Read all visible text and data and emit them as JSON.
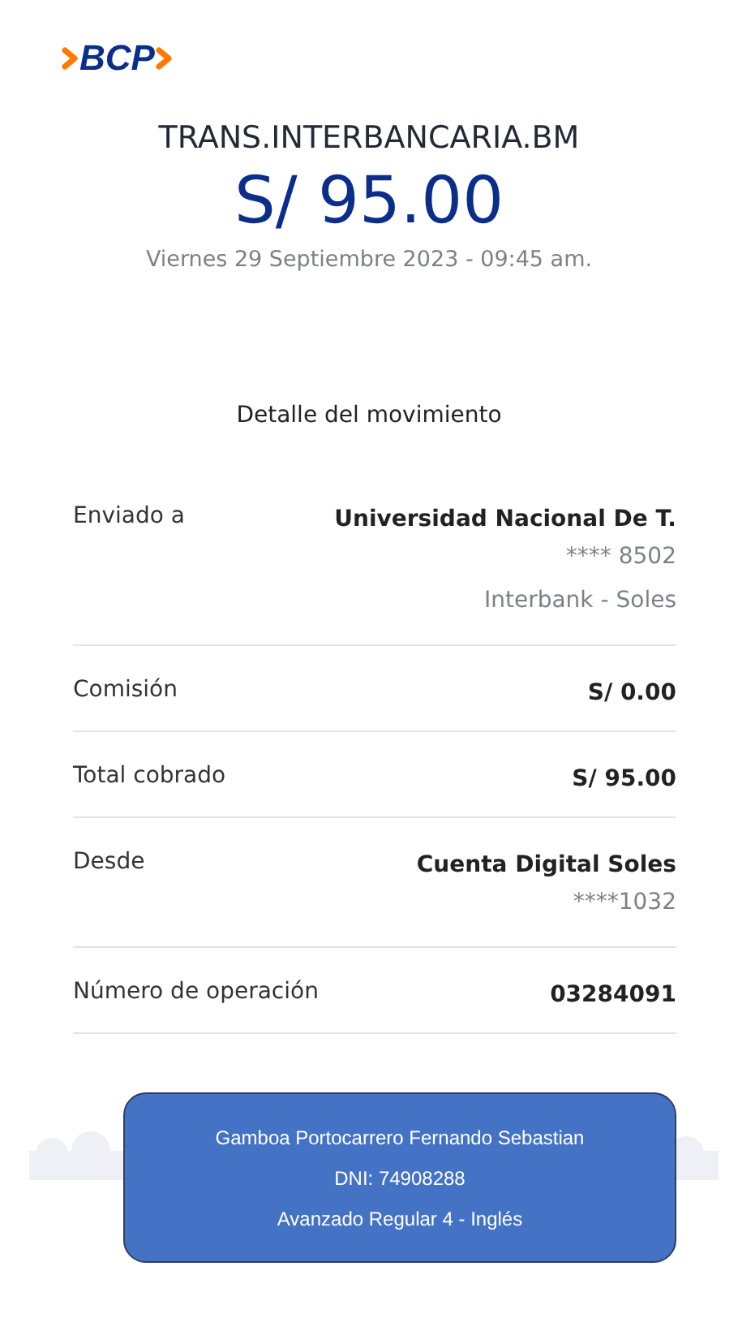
{
  "logo": {
    "text": "BCP"
  },
  "header": {
    "title": "TRANS.INTERBANCARIA.BM",
    "amount": "S/ 95.00",
    "date": "Viernes 29 Septiembre 2023 - 09:45 am."
  },
  "details": {
    "heading": "Detalle del movimiento",
    "rows": [
      {
        "label": "Enviado a",
        "values": [
          "Universidad Nacional De T.",
          "**** 8502",
          "Interbank - Soles"
        ]
      },
      {
        "label": "Comisión",
        "values": [
          "S/ 0.00"
        ]
      },
      {
        "label": "Total cobrado",
        "values": [
          "S/ 95.00"
        ]
      },
      {
        "label": "Desde",
        "values": [
          "Cuenta Digital Soles",
          "****1032"
        ]
      },
      {
        "label": "Número de operación",
        "values": [
          "03284091"
        ]
      }
    ]
  },
  "overlay_note": {
    "lines": [
      "Gamboa Portocarrero Fernando Sebastian",
      "DNI: 74908288",
      "Avanzado Regular 4 - Inglés"
    ]
  }
}
